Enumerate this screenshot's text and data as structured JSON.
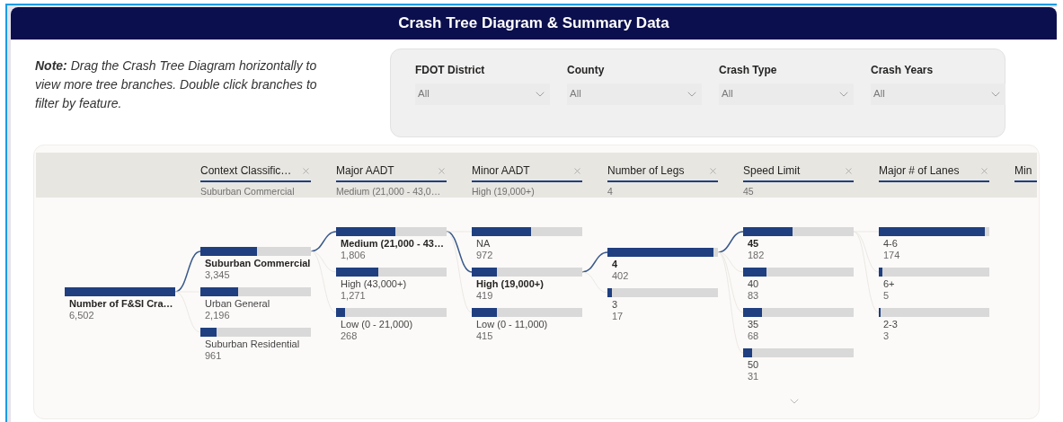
{
  "title": "Crash Tree Diagram & Summary Data",
  "note": "**Note:** Drag the Crash Tree Diagram horizontally to view more tree branches. Double click branches to filter by feature.",
  "filters": [
    {
      "label": "FDOT District",
      "value": "All"
    },
    {
      "label": "County",
      "value": "All"
    },
    {
      "label": "Crash Type",
      "value": "All"
    },
    {
      "label": "Crash Years",
      "value": "All"
    }
  ],
  "tree": {
    "columns": [
      {
        "nodes": [
          {
            "label": "Number of F&SI Cra…",
            "value": "6,502",
            "level": 1,
            "selected": true
          }
        ]
      },
      {
        "header": "Context Classific…",
        "subtitle": "Suburban Commercial",
        "nodes": [
          {
            "label": "Suburban Commercial",
            "value": "3,345",
            "level": 0.51,
            "selected": true
          },
          {
            "label": "Urban General",
            "value": "2,196",
            "level": 0.34,
            "selected": false
          },
          {
            "label": "Suburban Residential",
            "value": "961",
            "level": 0.15,
            "selected": false
          }
        ]
      },
      {
        "header": "Major AADT",
        "subtitle": "Medium (21,000 - 43,0…",
        "nodes": [
          {
            "label": "Medium (21,000 - 43…",
            "value": "1,806",
            "level": 0.54,
            "selected": true
          },
          {
            "label": "High (43,000+)",
            "value": "1,271",
            "level": 0.38,
            "selected": false
          },
          {
            "label": "Low (0 - 21,000)",
            "value": "268",
            "level": 0.08,
            "selected": false
          }
        ]
      },
      {
        "header": "Minor AADT",
        "subtitle": "High (19,000+)",
        "nodes": [
          {
            "label": "NA",
            "value": "972",
            "level": 0.54,
            "selected": false
          },
          {
            "label": "High (19,000+)",
            "value": "419",
            "level": 0.23,
            "selected": true
          },
          {
            "label": "Low (0 - 11,000)",
            "value": "415",
            "level": 0.23,
            "selected": false
          }
        ]
      },
      {
        "header": "Number of Legs",
        "subtitle": "4",
        "nodes": [
          {
            "label": "4",
            "value": "402",
            "level": 0.96,
            "selected": true
          },
          {
            "label": "3",
            "value": "17",
            "level": 0.04,
            "selected": false
          }
        ]
      },
      {
        "header": "Speed Limit",
        "subtitle": "45",
        "nodes": [
          {
            "label": "45",
            "value": "182",
            "level": 0.45,
            "selected": true
          },
          {
            "label": "40",
            "value": "83",
            "level": 0.21,
            "selected": false
          },
          {
            "label": "35",
            "value": "68",
            "level": 0.17,
            "selected": false
          },
          {
            "label": "50",
            "value": "31",
            "level": 0.08,
            "selected": false
          }
        ]
      },
      {
        "header": "Major # of Lanes",
        "nodes": [
          {
            "label": "4-6",
            "value": "174",
            "level": 0.96,
            "selected": false
          },
          {
            "label": "6+",
            "value": "5",
            "level": 0.03,
            "selected": false
          },
          {
            "label": "2-3",
            "value": "3",
            "level": 0.02,
            "selected": false
          }
        ]
      },
      {
        "header": "Min"
      }
    ]
  }
}
